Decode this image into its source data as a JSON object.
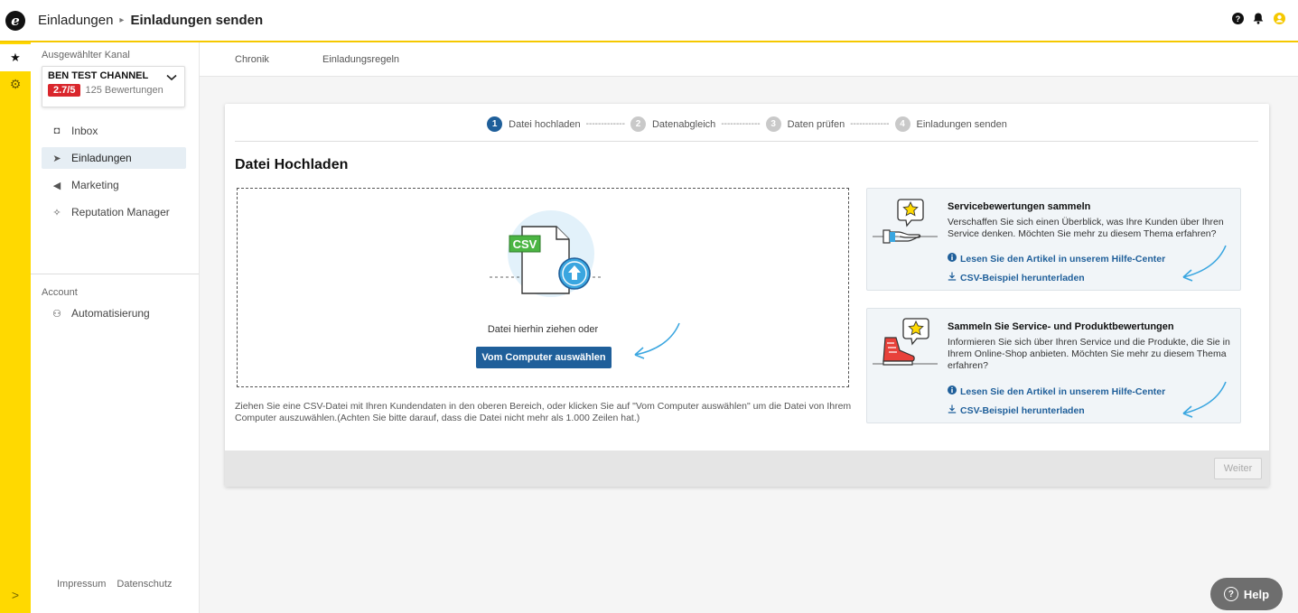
{
  "header": {
    "logo_letter": "e",
    "breadcrumb_parent": "Einladungen",
    "breadcrumb_separator": "▸",
    "breadcrumb_current": "Einladungen senden",
    "icons": [
      "help-icon",
      "bell-icon",
      "user-icon"
    ]
  },
  "rail": {
    "favorites_glyph": "★",
    "settings_glyph": "⚙",
    "expand_glyph": ">"
  },
  "sidebar": {
    "channel_label": "Ausgewählter Kanal",
    "channel_name": "BEN TEST CHANNEL",
    "channel_rating": "2.7/5",
    "channel_reviews": "125 Bewertungen",
    "items": [
      {
        "label": "Inbox",
        "icon": "inbox-icon",
        "glyph": "◘"
      },
      {
        "label": "Einladungen",
        "icon": "paper-plane-icon",
        "glyph": "➤"
      },
      {
        "label": "Marketing",
        "icon": "megaphone-icon",
        "glyph": "◀"
      },
      {
        "label": "Reputation Manager",
        "icon": "sparkle-icon",
        "glyph": "✧"
      }
    ],
    "account_label": "Account",
    "account_item": {
      "label": "Automatisierung",
      "icon": "robot-icon",
      "glyph": "⚇"
    },
    "footer_links": [
      "Impressum",
      "Datenschutz"
    ]
  },
  "tabs": [
    "Chronik",
    "Einladungsregeln"
  ],
  "stepper": {
    "steps": [
      {
        "num": "1",
        "label": "Datei hochladen",
        "active": true
      },
      {
        "num": "2",
        "label": "Datenabgleich",
        "active": false
      },
      {
        "num": "3",
        "label": "Daten prüfen",
        "active": false
      },
      {
        "num": "4",
        "label": "Einladungen senden",
        "active": false
      }
    ],
    "connector": "-------------"
  },
  "upload": {
    "title": "Datei Hochladen",
    "csv_label": "CSV",
    "drop_text": "Datei hierhin ziehen oder",
    "button_label": "Vom Computer auswählen",
    "hint": "Ziehen Sie eine CSV-Datei mit Ihren Kundendaten in den oberen Bereich, oder klicken Sie auf \"Vom Computer auswählen\" um die Datei von Ihrem Computer auszuwählen.(Achten Sie bitte darauf, dass die Datei nicht mehr als 1.000 Zeilen hat.)"
  },
  "info_cards": [
    {
      "title": "Servicebewertungen sammeln",
      "description": "Verschaffen Sie sich einen Überblick, was Ihre Kunden über Ihren Service denken. Möchten Sie mehr zu diesem Thema erfahren?",
      "link_article": "Lesen Sie den Artikel in unserem Hilfe-Center",
      "link_csv": "CSV-Beispiel herunterladen"
    },
    {
      "title": "Sammeln Sie Service- und Produktbewertungen",
      "description": "Informieren Sie sich über Ihren Service und die Produkte, die Sie in Ihrem Online-Shop anbieten. Möchten Sie mehr zu diesem Thema erfahren?",
      "link_article": "Lesen Sie den Artikel in unserem Hilfe-Center",
      "link_csv": "CSV-Beispiel herunterladen"
    }
  ],
  "footer": {
    "next_label": "Weiter"
  },
  "help": {
    "label": "Help",
    "glyph": "?"
  },
  "colors": {
    "brand_yellow": "#ffd900",
    "primary_blue": "#1f5f9a",
    "rating_red": "#d9262c",
    "annotation_arrow": "#3aa6e0"
  }
}
